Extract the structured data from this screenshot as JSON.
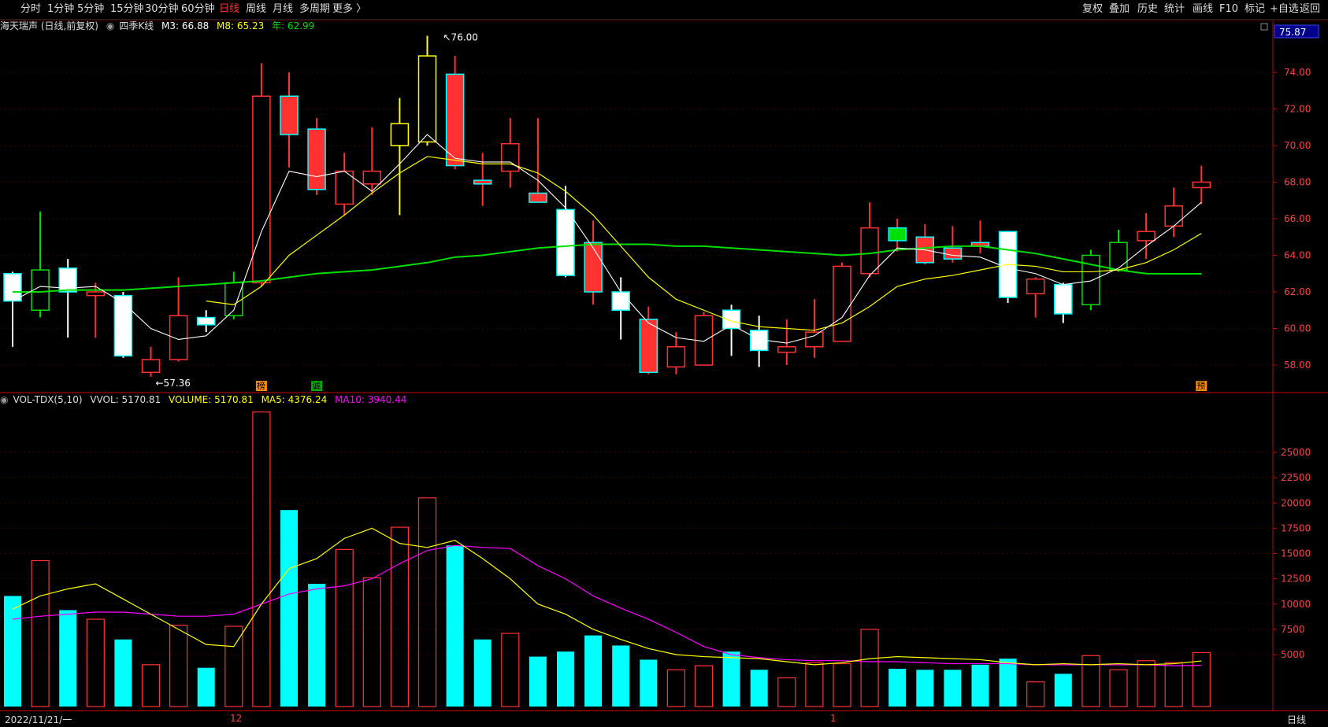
{
  "toolbar": {
    "left_items": [
      "分时",
      "1分钟",
      "5分钟",
      "15分钟",
      "30分钟",
      "60分钟",
      "日线",
      "周线",
      "月线",
      "多周期",
      "更多 〉"
    ],
    "active_index": 6,
    "right_items": [
      "复权",
      "叠加",
      "历史",
      "统计",
      "画线",
      "F10",
      "标记",
      "+自选",
      "返回"
    ]
  },
  "main_info": {
    "title": "海天瑞声 (日线,前复权)",
    "indicator": "四季K线",
    "m3": "M3: 66.88",
    "m8": "M8: 65.23",
    "year": "年: 62.99"
  },
  "vol_info": {
    "name": "VOL-TDX(5,10)",
    "vvol": "VVOL: 5170.81",
    "volume": "VOLUME: 5170.81",
    "ma5": "MA5: 4376.24",
    "ma10": "MA10: 3940.44"
  },
  "price_axis": {
    "current": "75.87",
    "ticks": [
      "74.00",
      "72.00",
      "70.00",
      "68.00",
      "66.00",
      "64.00",
      "62.00",
      "60.00",
      "58.00"
    ]
  },
  "vol_axis": {
    "ticks": [
      "25000",
      "22500",
      "20000",
      "17500",
      "15000",
      "12500",
      "10000",
      "7500",
      "5000"
    ]
  },
  "annotations": {
    "high_label": "76.00",
    "low_label": "57.36",
    "marker_a": "榜",
    "marker_b": "诚",
    "marker_c": "预"
  },
  "status": {
    "date": "2022/11/21/一",
    "month_mark_1": "12",
    "month_mark_2": "1",
    "period": "日线"
  },
  "colors": {
    "up": "#ff3232",
    "down": "#00ffff",
    "down_white": "#ffffff",
    "ma3": "#ffffff",
    "ma8": "#ffff00",
    "year": "#00e000",
    "ma5": "#ffff00",
    "ma10": "#ff00ff"
  },
  "chart_data": {
    "type": "candlestick",
    "candles": [
      {
        "o": 63.0,
        "h": 63.1,
        "l": 59.0,
        "c": 61.5,
        "kind": "down-white",
        "v": 10800
      },
      {
        "o": 61.0,
        "h": 66.4,
        "l": 60.6,
        "c": 63.2,
        "kind": "up-green",
        "v": 14300
      },
      {
        "o": 63.3,
        "h": 63.8,
        "l": 59.5,
        "c": 62.0,
        "kind": "down-white",
        "v": 9400
      },
      {
        "o": 62.0,
        "h": 62.5,
        "l": 59.5,
        "c": 61.8,
        "kind": "up",
        "v": 8500
      },
      {
        "o": 61.8,
        "h": 62.0,
        "l": 58.4,
        "c": 58.5,
        "kind": "down-white",
        "v": 6500
      },
      {
        "o": 58.3,
        "h": 59.0,
        "l": 57.36,
        "c": 57.6,
        "kind": "up",
        "v": 4000
      },
      {
        "o": 58.3,
        "h": 62.8,
        "l": 58.2,
        "c": 60.7,
        "kind": "up",
        "v": 7900
      },
      {
        "o": 60.6,
        "h": 61.0,
        "l": 59.8,
        "c": 60.2,
        "kind": "down-white",
        "v": 3700
      },
      {
        "o": 60.7,
        "h": 63.1,
        "l": 60.5,
        "c": 62.5,
        "kind": "up-green",
        "v": 7800
      },
      {
        "o": 62.5,
        "h": 74.5,
        "l": 62.3,
        "c": 72.7,
        "kind": "up",
        "v": 29000
      },
      {
        "o": 72.7,
        "h": 74.0,
        "l": 68.8,
        "c": 70.6,
        "kind": "down",
        "v": 19300
      },
      {
        "o": 70.9,
        "h": 71.5,
        "l": 67.3,
        "c": 67.6,
        "kind": "down",
        "v": 12000
      },
      {
        "o": 66.8,
        "h": 69.6,
        "l": 66.2,
        "c": 68.6,
        "kind": "up",
        "v": 15400
      },
      {
        "o": 67.9,
        "h": 71.0,
        "l": 67.3,
        "c": 68.6,
        "kind": "up",
        "v": 12600
      },
      {
        "o": 70.0,
        "h": 72.6,
        "l": 66.2,
        "c": 71.2,
        "kind": "up-yellow",
        "v": 17600
      },
      {
        "o": 70.2,
        "h": 76.0,
        "l": 70.0,
        "c": 74.9,
        "kind": "up-yellow",
        "v": 20500
      },
      {
        "o": 73.9,
        "h": 74.9,
        "l": 68.7,
        "c": 68.9,
        "kind": "down",
        "v": 15800
      },
      {
        "o": 67.9,
        "h": 69.6,
        "l": 66.7,
        "c": 68.1,
        "kind": "down",
        "v": 6500
      },
      {
        "o": 68.6,
        "h": 71.5,
        "l": 67.7,
        "c": 70.1,
        "kind": "up",
        "v": 7100
      },
      {
        "o": 67.4,
        "h": 71.5,
        "l": 66.9,
        "c": 66.9,
        "kind": "down",
        "v": 4800
      },
      {
        "o": 66.5,
        "h": 67.8,
        "l": 62.8,
        "c": 62.9,
        "kind": "down-white",
        "v": 5300
      },
      {
        "o": 64.7,
        "h": 65.9,
        "l": 61.3,
        "c": 62.0,
        "kind": "down",
        "v": 6900
      },
      {
        "o": 62.0,
        "h": 62.8,
        "l": 59.4,
        "c": 61.0,
        "kind": "down-white",
        "v": 5900
      },
      {
        "o": 60.5,
        "h": 61.2,
        "l": 57.5,
        "c": 57.6,
        "kind": "down",
        "v": 4500
      },
      {
        "o": 57.9,
        "h": 59.8,
        "l": 57.5,
        "c": 59.0,
        "kind": "up",
        "v": 3500
      },
      {
        "o": 58.0,
        "h": 60.9,
        "l": 58.0,
        "c": 60.7,
        "kind": "up",
        "v": 3900
      },
      {
        "o": 61.0,
        "h": 61.3,
        "l": 58.5,
        "c": 60.0,
        "kind": "down-white",
        "v": 5300
      },
      {
        "o": 59.9,
        "h": 60.7,
        "l": 57.9,
        "c": 58.8,
        "kind": "down-white",
        "v": 3500
      },
      {
        "o": 59.0,
        "h": 60.5,
        "l": 58.0,
        "c": 58.7,
        "kind": "up",
        "v": 2700
      },
      {
        "o": 59.0,
        "h": 61.6,
        "l": 58.4,
        "c": 59.8,
        "kind": "up",
        "v": 4200
      },
      {
        "o": 59.3,
        "h": 63.6,
        "l": 59.3,
        "c": 63.4,
        "kind": "up",
        "v": 4100
      },
      {
        "o": 63.0,
        "h": 66.9,
        "l": 62.8,
        "c": 65.5,
        "kind": "up",
        "v": 7500
      },
      {
        "o": 65.5,
        "h": 66.0,
        "l": 64.2,
        "c": 64.8,
        "kind": "down-green",
        "v": 3600
      },
      {
        "o": 65.0,
        "h": 65.7,
        "l": 63.5,
        "c": 63.6,
        "kind": "down",
        "v": 3500
      },
      {
        "o": 64.4,
        "h": 65.6,
        "l": 63.6,
        "c": 63.8,
        "kind": "down",
        "v": 3500
      },
      {
        "o": 64.7,
        "h": 65.9,
        "l": 64.1,
        "c": 64.5,
        "kind": "down",
        "v": 4000
      },
      {
        "o": 65.3,
        "h": 65.3,
        "l": 61.4,
        "c": 61.7,
        "kind": "down-white",
        "v": 4600
      },
      {
        "o": 61.9,
        "h": 62.8,
        "l": 60.6,
        "c": 62.7,
        "kind": "up",
        "v": 2300
      },
      {
        "o": 62.4,
        "h": 62.5,
        "l": 60.3,
        "c": 60.8,
        "kind": "down-white",
        "v": 3100
      },
      {
        "o": 61.3,
        "h": 64.3,
        "l": 61.0,
        "c": 64.0,
        "kind": "up-green",
        "v": 4900
      },
      {
        "o": 63.2,
        "h": 65.4,
        "l": 63.1,
        "c": 64.7,
        "kind": "up-green",
        "v": 3500
      },
      {
        "o": 64.8,
        "h": 66.3,
        "l": 63.8,
        "c": 65.3,
        "kind": "up",
        "v": 4400
      },
      {
        "o": 65.6,
        "h": 67.7,
        "l": 65.0,
        "c": 66.7,
        "kind": "up",
        "v": 4200
      },
      {
        "o": 67.7,
        "h": 68.9,
        "l": 66.8,
        "c": 68.0,
        "kind": "up",
        "v": 5200
      }
    ],
    "ma3": [
      61.5,
      62.3,
      62.2,
      62.3,
      61.4,
      60.0,
      59.4,
      59.6,
      61.0,
      65.3,
      68.6,
      68.3,
      68.6,
      67.5,
      69.0,
      70.6,
      69.3,
      69.1,
      69.1,
      68.1,
      66.6,
      64.4,
      62.0,
      60.3,
      59.5,
      59.3,
      60.2,
      59.4,
      59.2,
      59.6,
      60.6,
      62.9,
      64.4,
      64.3,
      64.0,
      63.9,
      63.3,
      63.0,
      62.4,
      62.6,
      63.3,
      64.5,
      65.6,
      66.9
    ],
    "ma8": [
      null,
      null,
      null,
      null,
      null,
      null,
      null,
      61.5,
      61.3,
      62.3,
      64.0,
      65.1,
      66.2,
      67.4,
      68.5,
      69.4,
      69.2,
      69.0,
      69.0,
      68.5,
      67.5,
      66.2,
      64.5,
      62.8,
      61.6,
      61.0,
      60.4,
      60.1,
      60.0,
      59.9,
      60.3,
      61.2,
      62.3,
      62.7,
      62.9,
      63.2,
      63.5,
      63.4,
      63.1,
      63.1,
      63.2,
      63.6,
      64.3,
      65.2
    ],
    "year": [
      62.0,
      62.0,
      62.1,
      62.1,
      62.1,
      62.2,
      62.3,
      62.4,
      62.5,
      62.6,
      62.8,
      63.0,
      63.1,
      63.2,
      63.4,
      63.6,
      63.9,
      64.0,
      64.2,
      64.4,
      64.5,
      64.6,
      64.6,
      64.6,
      64.5,
      64.5,
      64.4,
      64.3,
      64.2,
      64.1,
      64.0,
      64.1,
      64.3,
      64.4,
      64.5,
      64.5,
      64.3,
      64.1,
      63.8,
      63.5,
      63.2,
      63.0,
      62.99,
      62.99
    ],
    "vol_ma5": [
      9500,
      10800,
      11500,
      12000,
      10500,
      9000,
      7500,
      6000,
      5800,
      10000,
      13500,
      14500,
      16500,
      17500,
      16000,
      15600,
      16300,
      14500,
      12500,
      10000,
      9000,
      7500,
      6500,
      5600,
      5000,
      4800,
      4700,
      4600,
      4300,
      4000,
      4200,
      4600,
      4800,
      4700,
      4600,
      4500,
      4200,
      4000,
      4100,
      4000,
      4100,
      4000,
      4100,
      4376
    ],
    "vol_ma10": [
      8500,
      8800,
      9000,
      9200,
      9200,
      9000,
      8800,
      8800,
      9000,
      10000,
      11000,
      11500,
      11800,
      12500,
      14000,
      15300,
      15800,
      15600,
      15500,
      13800,
      12500,
      10800,
      9600,
      8500,
      7200,
      5800,
      5000,
      4700,
      4500,
      4400,
      4400,
      4300,
      4300,
      4200,
      4100,
      4100,
      4100,
      4000,
      4000,
      4000,
      4000,
      4000,
      3900,
      3940
    ]
  }
}
